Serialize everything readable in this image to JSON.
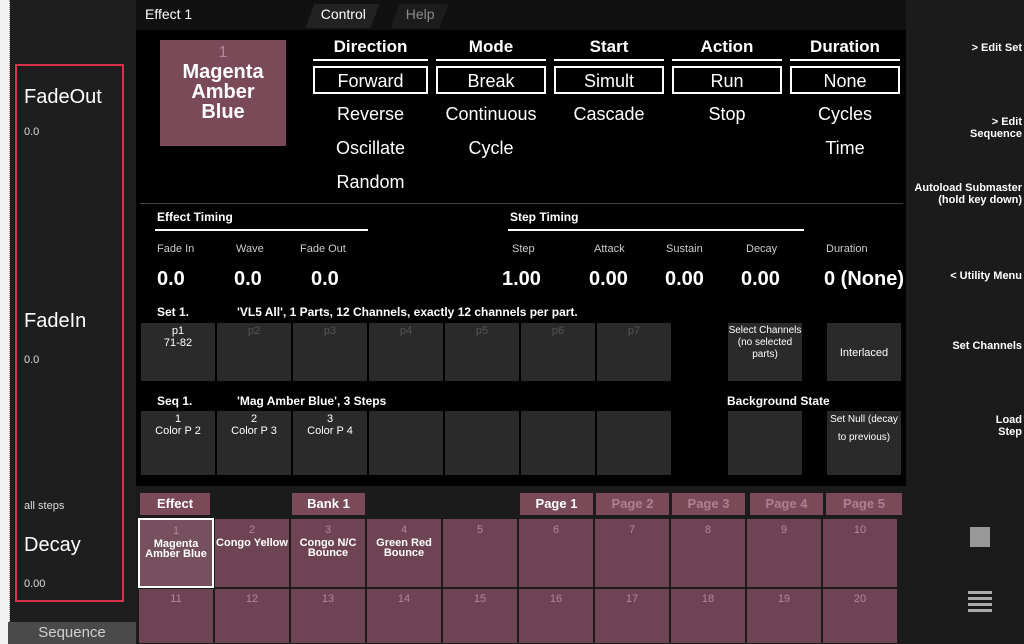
{
  "window": {
    "effect_title": "Effect 1",
    "tabs": [
      "Control",
      "Help"
    ]
  },
  "left": {
    "fadeout_label": "FadeOut",
    "fadeout_value": "0.0",
    "fadein_label": "FadeIn",
    "fadein_value": "0.0",
    "steps_label": "all steps",
    "decay_label": "Decay",
    "decay_value": "0.00",
    "sequence_tab": "Sequence"
  },
  "swatch": {
    "number": "1",
    "name_lines": [
      "Magenta",
      "Amber",
      "Blue"
    ]
  },
  "columns": {
    "direction": {
      "head": "Direction",
      "options": [
        "Forward",
        "Reverse",
        "Oscillate",
        "Random"
      ]
    },
    "mode": {
      "head": "Mode",
      "options": [
        "Break",
        "Continuous",
        "Cycle"
      ]
    },
    "start": {
      "head": "Start",
      "options": [
        "Simult",
        "Cascade"
      ]
    },
    "action": {
      "head": "Action",
      "options": [
        "Run",
        "Stop"
      ]
    },
    "duration": {
      "head": "Duration",
      "options": [
        "None",
        "Cycles",
        "Time"
      ]
    }
  },
  "timing": {
    "effect_title": "Effect Timing",
    "step_title": "Step Timing",
    "labels": [
      "Fade In",
      "Wave",
      "Fade Out",
      "Step",
      "Attack",
      "Sustain",
      "Decay",
      "Duration"
    ],
    "values": [
      "0.0",
      "0.0",
      "0.0",
      "1.00",
      "0.00",
      "0.00",
      "0.00",
      "0 (None)"
    ]
  },
  "set": {
    "head": "Set 1.",
    "desc": "'VL5 All', 1 Parts, 12 Channels, exactly 12 channels per part.",
    "parts": [
      "p1",
      "p2",
      "p3",
      "p4",
      "p5",
      "p6",
      "p7"
    ],
    "p1_range": "71-82",
    "select_channels": "Select Channels (no selected parts)",
    "interlaced": "Interlaced"
  },
  "seq": {
    "head": "Seq 1.",
    "desc": "'Mag Amber Blue', 3 Steps",
    "bg_state": "Background State",
    "steps": [
      {
        "n": "1",
        "c": "Color P 2"
      },
      {
        "n": "2",
        "c": "Color P 3"
      },
      {
        "n": "3",
        "c": "Color P 4"
      }
    ],
    "set_null": "Set Null (decay to previous)"
  },
  "bank": {
    "effect": "Effect",
    "bank": "Bank 1",
    "pages": [
      "Page 1",
      "Page 2",
      "Page 3",
      "Page 4",
      "Page 5"
    ]
  },
  "effects_row1": [
    {
      "n": "1",
      "name": "Magenta Amber Blue"
    },
    {
      "n": "2",
      "name": "Congo Yellow"
    },
    {
      "n": "3",
      "name": "Congo N/C Bounce"
    },
    {
      "n": "4",
      "name": "Green Red Bounce"
    },
    {
      "n": "5",
      "name": ""
    },
    {
      "n": "6",
      "name": ""
    },
    {
      "n": "7",
      "name": ""
    },
    {
      "n": "8",
      "name": ""
    },
    {
      "n": "9",
      "name": ""
    },
    {
      "n": "10",
      "name": ""
    }
  ],
  "effects_row2": [
    "11",
    "12",
    "13",
    "14",
    "15",
    "16",
    "17",
    "18",
    "19",
    "20"
  ],
  "right": {
    "edit_set": "> Edit Set",
    "edit_sequence": "> Edit Sequence",
    "autoload": "Autoload Submaster (hold key down)",
    "utility": "< Utility Menu",
    "set_channels": "Set Channels",
    "load_step": "Load Step"
  },
  "icons": {
    "stop": "stop-icon",
    "menu": "menu-icon"
  }
}
